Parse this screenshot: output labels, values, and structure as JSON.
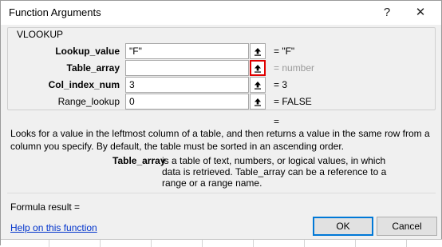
{
  "window": {
    "title": "Function Arguments",
    "help_glyph": "?",
    "close_glyph": "✕"
  },
  "group": {
    "label": "VLOOKUP"
  },
  "args": [
    {
      "label": "Lookup_value",
      "value": "\"F\"",
      "result": "=  \"F\""
    },
    {
      "label": "Table_array",
      "value": "",
      "result": "=  number"
    },
    {
      "label": "Col_index_num",
      "value": "3",
      "result": "=  3"
    },
    {
      "label": "Range_lookup",
      "value": "0",
      "result": "=  FALSE"
    }
  ],
  "function_result": "=",
  "description": "Looks for a value in the leftmost column of a table, and then returns a value in the same row from a column you specify. By default, the table must be sorted in an ascending order.",
  "arg_help": {
    "name": "Table_array",
    "text": "is a table of text, numbers, or logical values, in which data is retrieved. Table_array can be a reference to a range or a range name."
  },
  "formula_result": "Formula result =",
  "help_link": "Help on this function",
  "buttons": {
    "ok": "OK",
    "cancel": "Cancel"
  },
  "colors": {
    "active_outline": "#e00000",
    "link": "#0033cc",
    "default_button": "#0078d7"
  }
}
